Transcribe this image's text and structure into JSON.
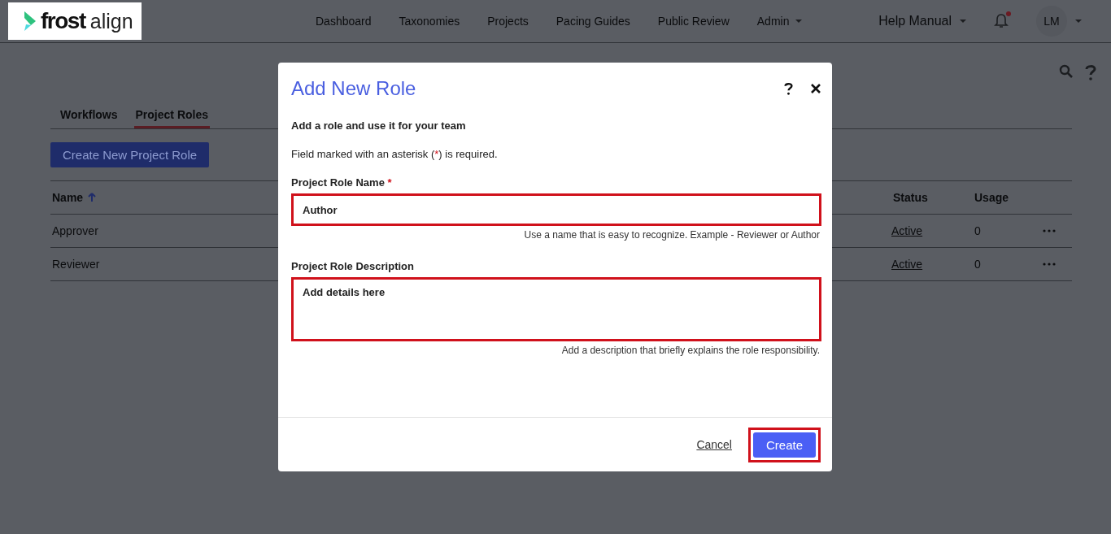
{
  "header": {
    "logo": {
      "word": "frost",
      "suffix": "align"
    },
    "nav": [
      {
        "label": "Dashboard",
        "dropdown": false
      },
      {
        "label": "Taxonomies",
        "dropdown": false
      },
      {
        "label": "Projects",
        "dropdown": false
      },
      {
        "label": "Pacing Guides",
        "dropdown": false
      },
      {
        "label": "Public Review",
        "dropdown": false
      },
      {
        "label": "Admin",
        "dropdown": true
      }
    ],
    "help_menu": "Help Manual",
    "notification_unread": true,
    "user_initials": "LM"
  },
  "page": {
    "tabs": [
      {
        "label": "Workflows",
        "selected": false
      },
      {
        "label": "Project Roles",
        "selected": true
      }
    ],
    "create_button": "Create New Project Role",
    "table": {
      "columns": [
        {
          "label": "Name",
          "sorted": true
        },
        {
          "label": "Status",
          "sorted": false
        },
        {
          "label": "Usage",
          "sorted": false
        }
      ],
      "rows": [
        {
          "name": "Approver",
          "status": "Active",
          "usage": "0"
        },
        {
          "name": "Reviewer",
          "status": "Active",
          "usage": "0"
        }
      ]
    }
  },
  "dialog": {
    "title": "Add New Role",
    "subtitle": "Add a role and use it for your team",
    "note": {
      "before": "Field marked with an asterisk (",
      "mark": "*",
      "after": ") is required."
    },
    "fields": [
      {
        "kind": "input",
        "label": "Project Role Name",
        "required_mark": "*",
        "value": "Author",
        "hint": "Use a name that is easy to recognize. Example - Reviewer or Author",
        "highlighted": true
      },
      {
        "kind": "textarea",
        "label": "Project Role Description",
        "value": "Add details here",
        "hint": "Add a description that briefly explains the role responsibility.",
        "highlighted": true
      }
    ],
    "cancel": "Cancel",
    "create": {
      "label": "Create",
      "highlighted": true
    }
  }
}
